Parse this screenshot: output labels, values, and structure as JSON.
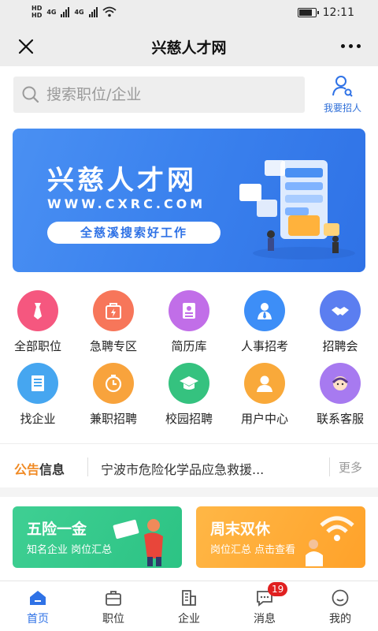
{
  "status_bar": {
    "hd1": "HD",
    "net1": "4G",
    "hd2": "HD",
    "net2": "4G",
    "time": "12:11"
  },
  "title_bar": {
    "title": "兴慈人才网"
  },
  "search": {
    "placeholder": "搜索职位/企业"
  },
  "recruit": {
    "label": "我要招人"
  },
  "banner": {
    "title": "兴慈人才网",
    "url": "WWW.CXRC.COM",
    "slogan": "全慈溪搜索好工作"
  },
  "grid": [
    {
      "label": "全部职位",
      "icon": "tie-icon",
      "color": "#f5577f"
    },
    {
      "label": "急聘专区",
      "icon": "urgent-bag-icon",
      "color": "#f7765a"
    },
    {
      "label": "简历库",
      "icon": "resume-icon",
      "color": "#c16ee8"
    },
    {
      "label": "人事招考",
      "icon": "person-tie-icon",
      "color": "#3d8ef7"
    },
    {
      "label": "招聘会",
      "icon": "handshake-icon",
      "color": "#5b7ef0"
    },
    {
      "label": "找企业",
      "icon": "company-icon",
      "color": "#46a6f0"
    },
    {
      "label": "兼职招聘",
      "icon": "clock-icon",
      "color": "#f8a33c"
    },
    {
      "label": "校园招聘",
      "icon": "graduation-cap-icon",
      "color": "#35c27f"
    },
    {
      "label": "用户中心",
      "icon": "user-icon",
      "color": "#f9a93a"
    },
    {
      "label": "联系客服",
      "icon": "service-icon",
      "color": "#a77af0"
    }
  ],
  "notice": {
    "tag_a": "公告",
    "tag_b": "信息",
    "text": "宁波市危险化学品应急救援...",
    "more": "更多"
  },
  "cards": {
    "left": {
      "title": "五险一金",
      "sub": "知名企业 岗位汇总"
    },
    "right": {
      "title": "周末双休",
      "sub": "岗位汇总 点击查看"
    }
  },
  "bottom_nav": {
    "items": [
      {
        "label": "首页",
        "icon": "home-icon"
      },
      {
        "label": "职位",
        "icon": "briefcase-icon"
      },
      {
        "label": "企业",
        "icon": "building-icon"
      },
      {
        "label": "消息",
        "icon": "message-icon",
        "badge": "19"
      },
      {
        "label": "我的",
        "icon": "profile-icon"
      }
    ]
  },
  "colors": {
    "accent": "#2f72e6",
    "notice_orange": "#f08a24",
    "badge_red": "#e02020"
  }
}
